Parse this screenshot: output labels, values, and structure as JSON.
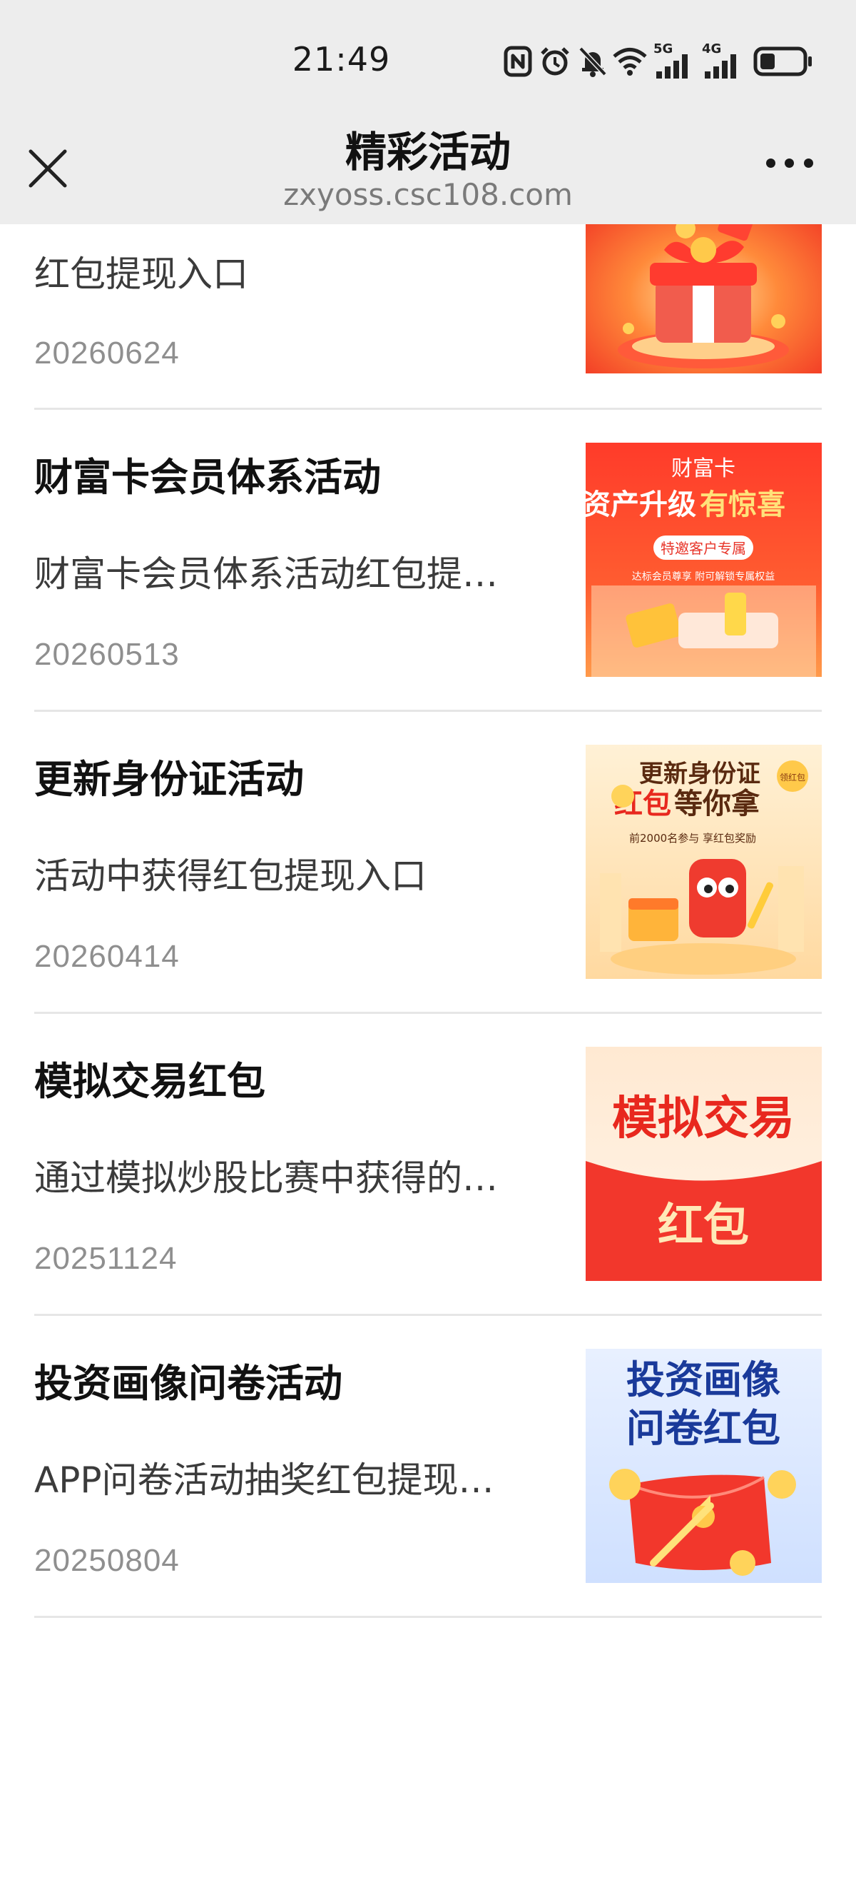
{
  "status_bar": {
    "time": "21:49",
    "icons": [
      "nfc-icon",
      "alarm-icon",
      "mute-icon",
      "wifi-icon",
      "signal-5g-icon",
      "signal-4g-icon",
      "battery-icon"
    ],
    "network_5g": "5G",
    "network_4g": "4G"
  },
  "nav": {
    "title": "精彩活动",
    "url": "zxyoss.csc108.com"
  },
  "items": [
    {
      "title": "",
      "desc": "红包提现入口",
      "date": "20260624",
      "thumb_icon": "gift-box-icon"
    },
    {
      "title": "财富卡会员体系活动",
      "desc": "财富卡会员体系活动红包提…",
      "date": "20260513",
      "thumb_text": {
        "top": "财富卡",
        "main_left": "资产升级",
        "main_right": "有惊喜",
        "badge": "特邀客户专属",
        "sub": "达标会员尊享 附可解锁专属权益"
      }
    },
    {
      "title": "更新身份证活动",
      "desc": "活动中获得红包提现入口",
      "date": "20260414",
      "thumb_text": {
        "line1": "更新身份证",
        "line2_left": "红包",
        "line2_right": "等你拿",
        "sub": "前2000名参与  享红包奖励",
        "tag": "领红包"
      }
    },
    {
      "title": "模拟交易红包",
      "desc": "通过模拟炒股比赛中获得的…",
      "date": "20251124",
      "thumb_text": {
        "top": "模拟交易",
        "bottom": "红包"
      }
    },
    {
      "title": "投资画像问卷活动",
      "desc": "APP问卷活动抽奖红包提现…",
      "date": "20250804",
      "thumb_text": {
        "line1": "投资画像",
        "line2": "问卷红包"
      }
    }
  ],
  "colors": {
    "header_bg": "#ededed",
    "brand_red": "#f2372c",
    "title_text": "#111111",
    "date_text": "#8f8f8f"
  }
}
